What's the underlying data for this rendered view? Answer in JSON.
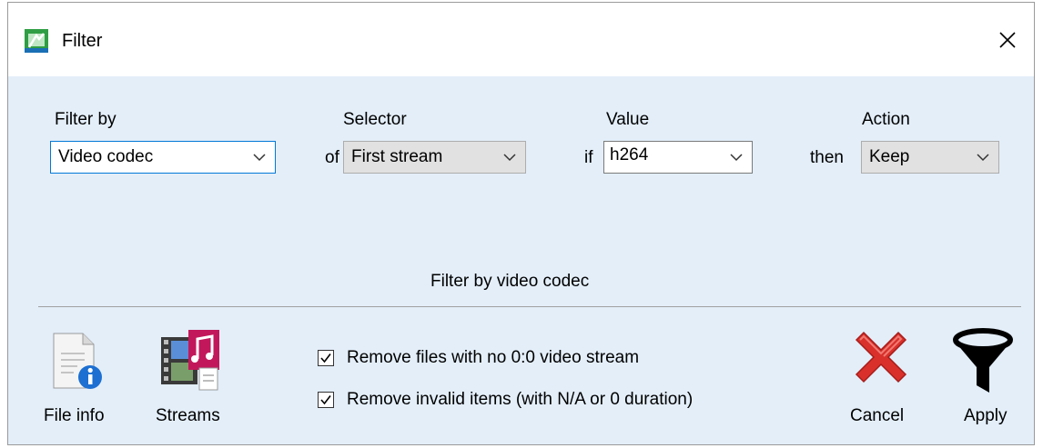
{
  "window": {
    "title": "Filter"
  },
  "filter": {
    "filter_by_label": "Filter by",
    "filter_by_value": "Video codec",
    "selector_label": "Selector",
    "of_label": "of",
    "selector_value": "First stream",
    "value_label": "Value",
    "if_label": "if",
    "value_value": "h264",
    "action_label": "Action",
    "then_label": "then",
    "action_value": "Keep",
    "description": "Filter by video codec"
  },
  "toolbar": {
    "file_info_label": "File info",
    "streams_label": "Streams",
    "cancel_label": "Cancel",
    "apply_label": "Apply"
  },
  "options": {
    "remove_no_video_label": "Remove files with no 0:0 video stream",
    "remove_no_video_checked": true,
    "remove_invalid_label": "Remove invalid items (with N/A or 0 duration)",
    "remove_invalid_checked": true
  },
  "colors": {
    "focus_border": "#0078d7",
    "dialog_bg": "#e3eef9",
    "cancel_red": "#d9302b"
  },
  "icons": [
    "app-icon",
    "close-icon",
    "file-info-icon",
    "streams-icon",
    "cancel-icon",
    "apply-funnel-icon",
    "chevron-down-icon",
    "checkmark-icon"
  ]
}
